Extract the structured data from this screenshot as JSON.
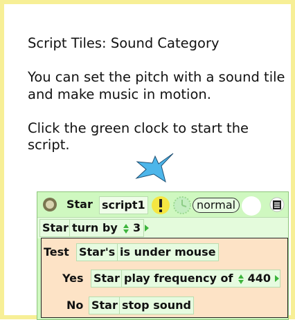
{
  "instructions": {
    "title": "Script Tiles: Sound Category",
    "line1": "You can set the pitch with a sound tile and make music in motion.",
    "line2": "Click the green clock to start the script."
  },
  "script": {
    "player": "Star",
    "name": "script1",
    "mode": "normal"
  },
  "rows": {
    "turn": {
      "player": "Star",
      "command": "turn by",
      "value": "3"
    },
    "test": {
      "label": "Test",
      "player": "Star's",
      "condition": "is under mouse"
    },
    "yes": {
      "label": "Yes",
      "player": "Star",
      "command": "play frequency of",
      "value": "440"
    },
    "no": {
      "label": "No",
      "player": "Star",
      "command": "stop sound"
    }
  },
  "colors": {
    "frame_border": "#f7ef96",
    "script_background": "#cff8c0",
    "tile_background": "#e6fbe0",
    "test_box": "#fde3c6",
    "star_fill": "#4db6ea",
    "alert_yellow": "#f5e642",
    "arrow_green": "#3cb43c"
  },
  "icons": [
    "menu-dot-icon",
    "exclamation-icon",
    "clock-icon",
    "step-circle-icon",
    "script-menu-icon",
    "arrow-up-icon",
    "arrow-down-icon",
    "arrow-right-icon"
  ]
}
